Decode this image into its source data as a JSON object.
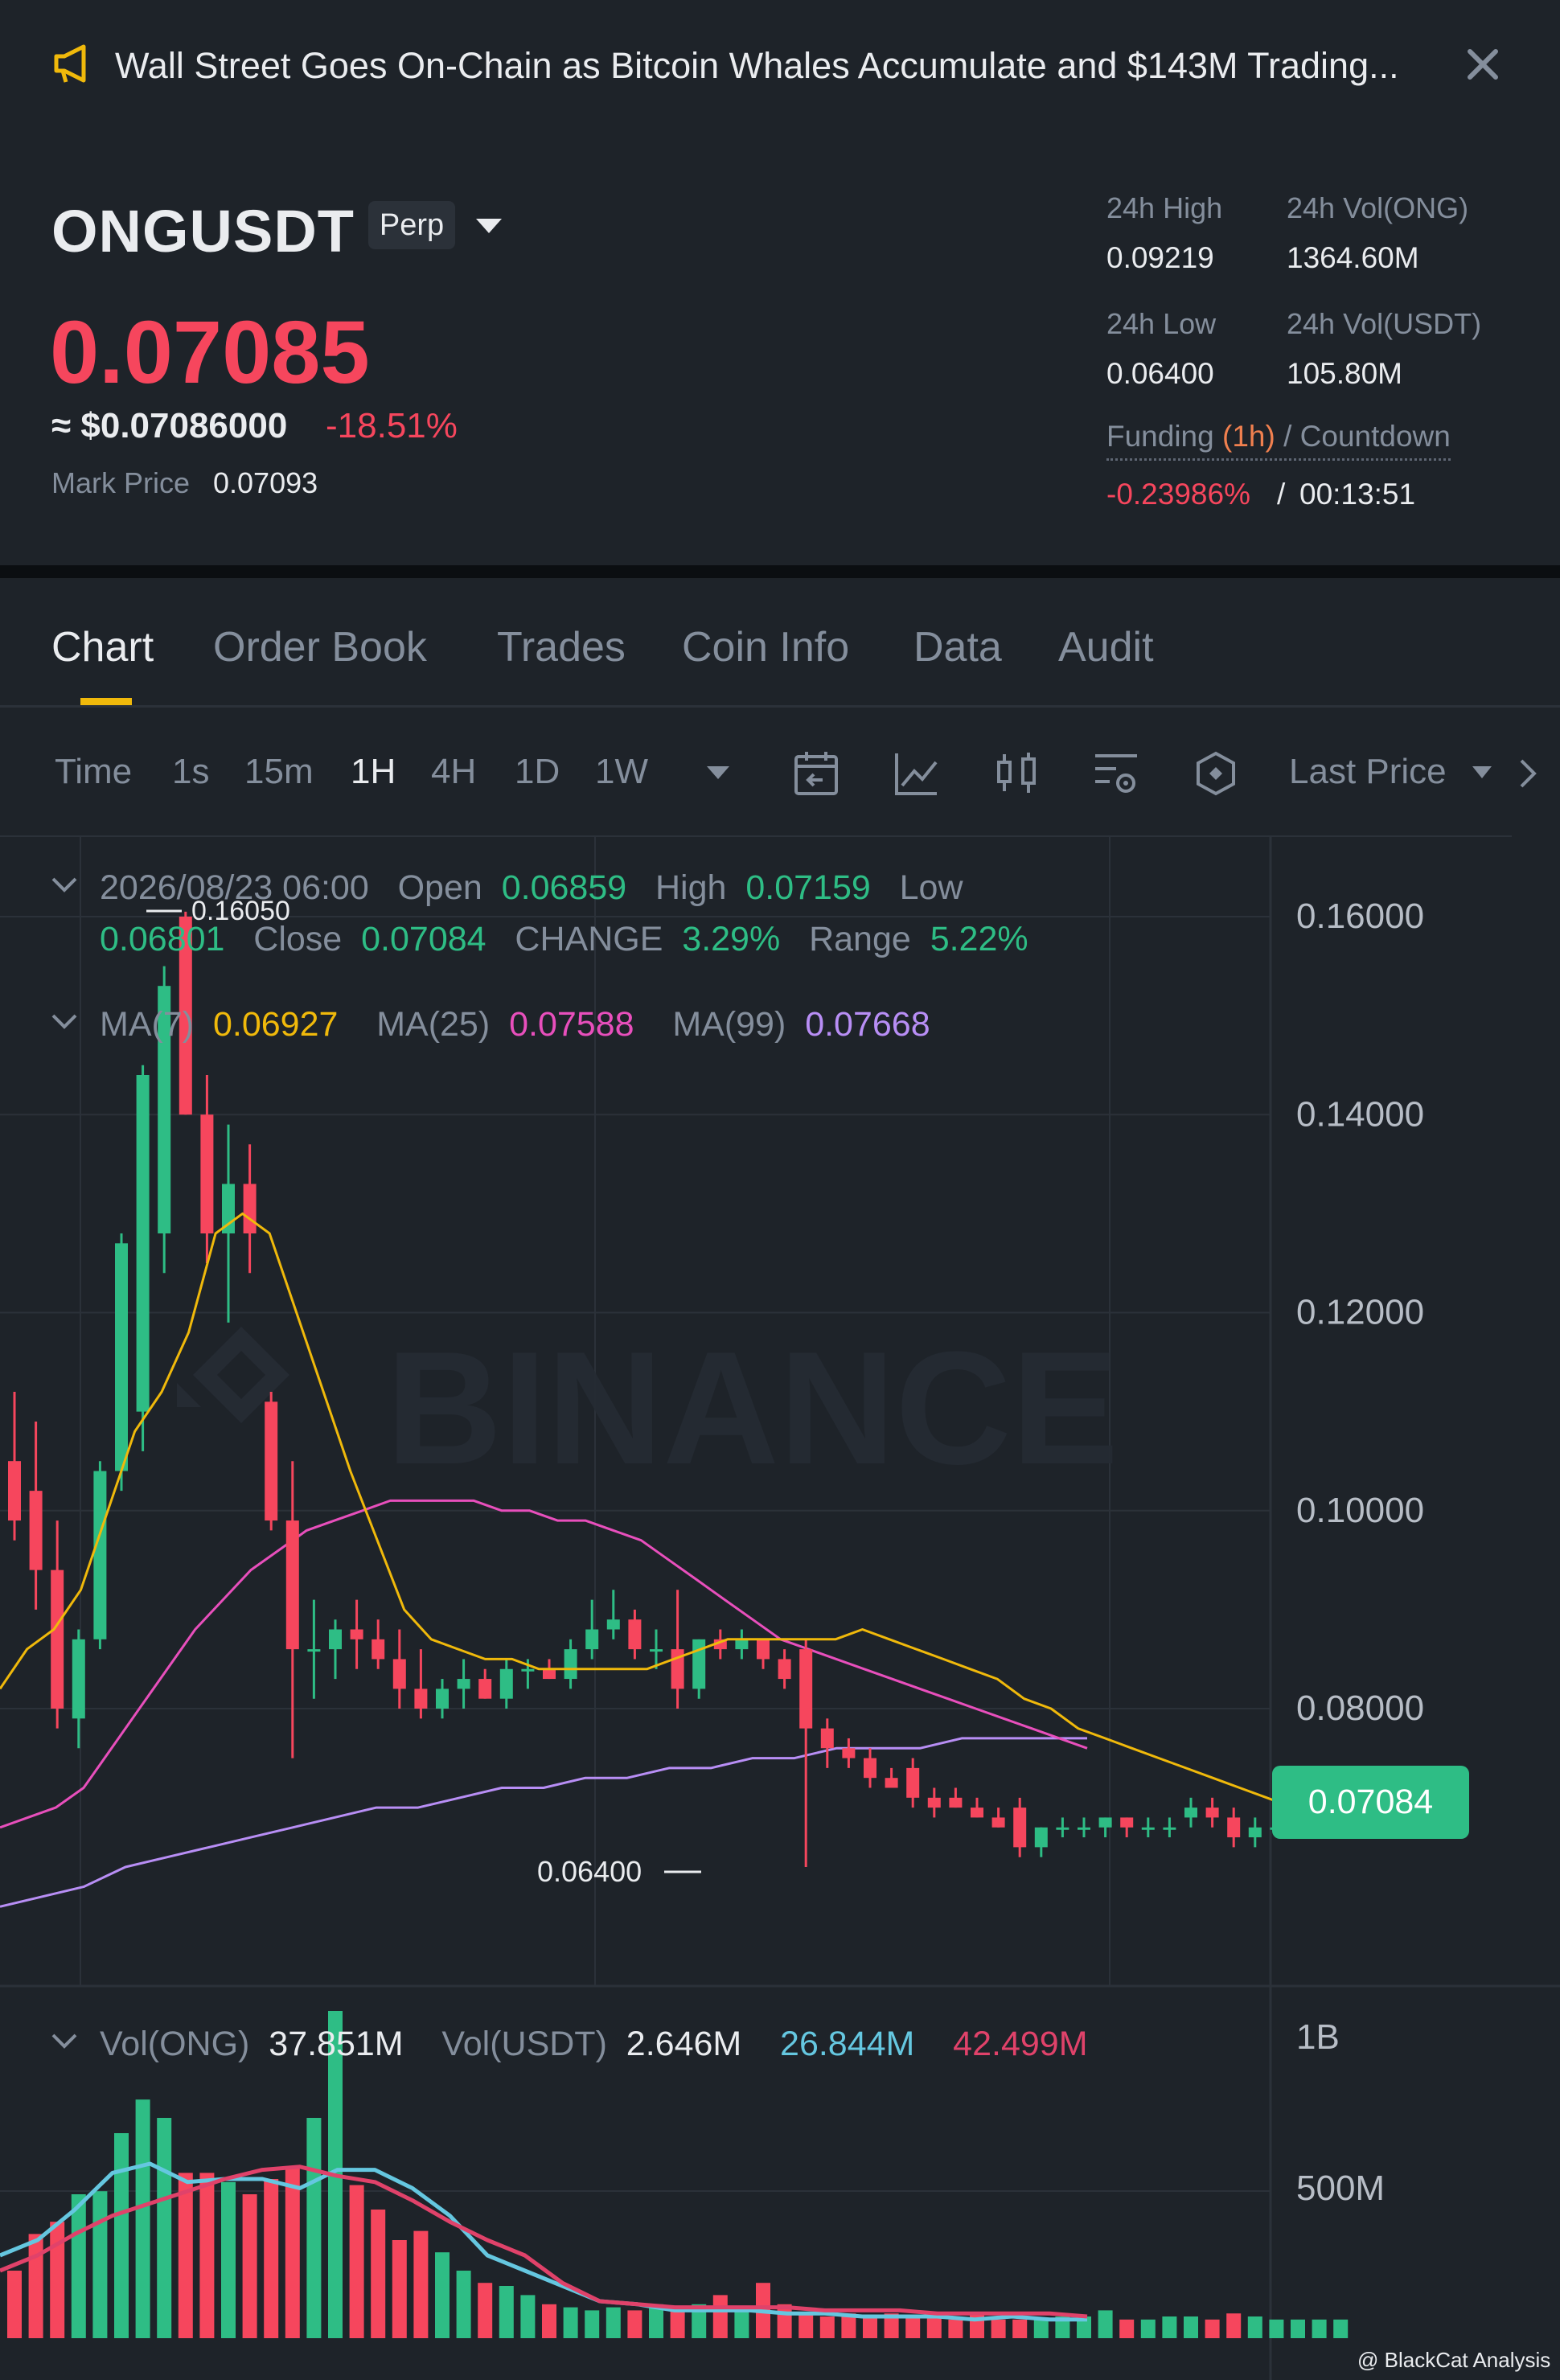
{
  "announcement": {
    "text": "Wall Street Goes On-Chain as Bitcoin Whales Accumulate and $143M Trading..."
  },
  "ticker": {
    "symbol": "ONGUSDT",
    "badge": "Perp",
    "last_price": "0.07085",
    "usd_price": "≈ $0.07086000",
    "change_pct": "-18.51%",
    "mark_label": "Mark Price",
    "mark_value": "0.07093"
  },
  "stats": {
    "high_label": "24h High",
    "high_value": "0.09219",
    "vol_ong_label": "24h Vol(ONG)",
    "vol_ong_value": "1364.60M",
    "low_label": "24h Low",
    "low_value": "0.06400",
    "vol_usdt_label": "24h Vol(USDT)",
    "vol_usdt_value": "105.80M",
    "funding_label": "Funding",
    "funding_interval": "(1h)",
    "countdown_label": "/ Countdown",
    "funding_rate": "-0.23986%",
    "funding_sep": "/",
    "countdown": "00:13:51"
  },
  "tabs": [
    "Chart",
    "Order Book",
    "Trades",
    "Coin Info",
    "Data",
    "Audit"
  ],
  "toolbar": {
    "intervals": [
      "Time",
      "1s",
      "15m",
      "1H",
      "4H",
      "1D",
      "1W"
    ],
    "active_interval": "1H",
    "price_type": "Last Price",
    "icons": [
      "dropdown-icon",
      "calendar-icon",
      "indicator-icon",
      "candle-settings-icon",
      "drawing-settings-icon",
      "shape-icon",
      "chevron-right-icon"
    ]
  },
  "ohlc": {
    "datetime": "2026/08/23 06:00",
    "open_label": "Open",
    "open": "0.06859",
    "high_label": "High",
    "high": "0.07159",
    "low_label": "Low",
    "low": "0.06801",
    "close_label": "Close",
    "close": "0.07084",
    "change_label": "CHANGE",
    "change": "3.29%",
    "range_label": "Range",
    "range": "5.22%"
  },
  "ma": {
    "ma7_label": "MA(7)",
    "ma7": "0.06927",
    "ma25_label": "MA(25)",
    "ma25": "0.07588",
    "ma99_label": "MA(99)",
    "ma99": "0.07668"
  },
  "volume": {
    "vol_ong_label": "Vol(ONG)",
    "vol_ong": "37.851M",
    "vol_usdt_label": "Vol(USDT)",
    "vol_usdt": "2.646M",
    "ma1": "26.844M",
    "ma2": "42.499M"
  },
  "watermark": "BINANCE",
  "attribution": "@ BlackCat Analysis",
  "colors": {
    "up": "#2ebd85",
    "down": "#f6465d",
    "accent": "#f0b90b",
    "ma7": "#f0b90b",
    "ma25": "#e84fbc",
    "ma99": "#b88ef5",
    "vol_ma1": "#65c7e0",
    "vol_ma2": "#e0426a"
  },
  "chart_data": {
    "type": "candlestick",
    "y_ticks": [
      "0.16000",
      "0.14000",
      "0.12000",
      "0.10000",
      "0.08000"
    ],
    "ylim": [
      0.058,
      0.168
    ],
    "current_price": "0.07084",
    "high_marker": "0.16050",
    "low_marker": "0.06400",
    "candles": [
      [
        0.105,
        0.112,
        0.097,
        0.099
      ],
      [
        0.102,
        0.109,
        0.09,
        0.094
      ],
      [
        0.094,
        0.099,
        0.078,
        0.08
      ],
      [
        0.079,
        0.088,
        0.076,
        0.087
      ],
      [
        0.087,
        0.105,
        0.086,
        0.104
      ],
      [
        0.104,
        0.128,
        0.102,
        0.127
      ],
      [
        0.11,
        0.145,
        0.106,
        0.144
      ],
      [
        0.128,
        0.155,
        0.124,
        0.153
      ],
      [
        0.16,
        0.1605,
        0.14,
        0.14
      ],
      [
        0.14,
        0.144,
        0.125,
        0.128
      ],
      [
        0.128,
        0.139,
        0.119,
        0.133
      ],
      [
        0.133,
        0.137,
        0.124,
        0.128
      ],
      [
        0.111,
        0.112,
        0.098,
        0.099
      ],
      [
        0.099,
        0.105,
        0.075,
        0.086
      ],
      [
        0.086,
        0.091,
        0.081,
        0.086
      ],
      [
        0.086,
        0.089,
        0.083,
        0.088
      ],
      [
        0.088,
        0.091,
        0.084,
        0.087
      ],
      [
        0.087,
        0.089,
        0.084,
        0.085
      ],
      [
        0.085,
        0.088,
        0.08,
        0.082
      ],
      [
        0.082,
        0.086,
        0.079,
        0.08
      ],
      [
        0.08,
        0.083,
        0.079,
        0.082
      ],
      [
        0.082,
        0.085,
        0.08,
        0.083
      ],
      [
        0.083,
        0.084,
        0.081,
        0.081
      ],
      [
        0.081,
        0.085,
        0.08,
        0.084
      ],
      [
        0.084,
        0.085,
        0.082,
        0.084
      ],
      [
        0.084,
        0.085,
        0.083,
        0.083
      ],
      [
        0.083,
        0.087,
        0.082,
        0.086
      ],
      [
        0.086,
        0.091,
        0.085,
        0.088
      ],
      [
        0.088,
        0.092,
        0.087,
        0.089
      ],
      [
        0.089,
        0.09,
        0.085,
        0.086
      ],
      [
        0.086,
        0.088,
        0.084,
        0.086
      ],
      [
        0.086,
        0.092,
        0.08,
        0.082
      ],
      [
        0.082,
        0.087,
        0.081,
        0.087
      ],
      [
        0.087,
        0.088,
        0.085,
        0.086
      ],
      [
        0.086,
        0.088,
        0.085,
        0.087
      ],
      [
        0.087,
        0.087,
        0.084,
        0.085
      ],
      [
        0.085,
        0.086,
        0.082,
        0.083
      ],
      [
        0.086,
        0.087,
        0.064,
        0.078
      ],
      [
        0.078,
        0.079,
        0.074,
        0.076
      ],
      [
        0.076,
        0.077,
        0.074,
        0.075
      ],
      [
        0.075,
        0.076,
        0.072,
        0.073
      ],
      [
        0.073,
        0.074,
        0.072,
        0.072
      ],
      [
        0.074,
        0.075,
        0.07,
        0.071
      ],
      [
        0.071,
        0.072,
        0.069,
        0.07
      ],
      [
        0.071,
        0.072,
        0.07,
        0.07
      ],
      [
        0.07,
        0.071,
        0.069,
        0.069
      ],
      [
        0.069,
        0.07,
        0.068,
        0.068
      ],
      [
        0.07,
        0.071,
        0.065,
        0.066
      ],
      [
        0.066,
        0.068,
        0.065,
        0.068
      ],
      [
        0.068,
        0.069,
        0.067,
        0.068
      ],
      [
        0.068,
        0.069,
        0.067,
        0.068
      ],
      [
        0.068,
        0.069,
        0.067,
        0.069
      ],
      [
        0.069,
        0.069,
        0.067,
        0.068
      ],
      [
        0.068,
        0.069,
        0.067,
        0.068
      ],
      [
        0.068,
        0.069,
        0.067,
        0.068
      ],
      [
        0.069,
        0.071,
        0.068,
        0.07
      ],
      [
        0.07,
        0.071,
        0.068,
        0.069
      ],
      [
        0.069,
        0.07,
        0.066,
        0.067
      ],
      [
        0.067,
        0.069,
        0.066,
        0.068
      ],
      [
        0.068,
        0.069,
        0.067,
        0.068
      ],
      [
        0.068,
        0.07,
        0.068,
        0.069
      ],
      [
        0.069,
        0.071,
        0.068,
        0.07
      ],
      [
        0.068,
        0.072,
        0.068,
        0.071
      ]
    ],
    "ma7": [
      0.082,
      0.086,
      0.088,
      0.092,
      0.1,
      0.108,
      0.112,
      0.118,
      0.128,
      0.13,
      0.128,
      0.12,
      0.112,
      0.104,
      0.097,
      0.09,
      0.087,
      0.086,
      0.085,
      0.085,
      0.084,
      0.084,
      0.084,
      0.084,
      0.084,
      0.085,
      0.086,
      0.087,
      0.087,
      0.087,
      0.087,
      0.087,
      0.088,
      0.087,
      0.086,
      0.085,
      0.084,
      0.083,
      0.081,
      0.08,
      0.078,
      0.077,
      0.076,
      0.075,
      0.074,
      0.073,
      0.072,
      0.071,
      0.07,
      0.07,
      0.069,
      0.069,
      0.069,
      0.069
    ],
    "ma25": [
      0.068,
      0.069,
      0.07,
      0.072,
      0.076,
      0.08,
      0.084,
      0.088,
      0.091,
      0.094,
      0.096,
      0.098,
      0.099,
      0.1,
      0.101,
      0.101,
      0.101,
      0.101,
      0.1,
      0.1,
      0.099,
      0.099,
      0.098,
      0.097,
      0.095,
      0.093,
      0.091,
      0.089,
      0.087,
      0.086,
      0.085,
      0.084,
      0.083,
      0.082,
      0.081,
      0.08,
      0.079,
      0.078,
      0.077,
      0.076
    ],
    "ma99": [
      0.06,
      0.061,
      0.062,
      0.064,
      0.065,
      0.066,
      0.067,
      0.068,
      0.069,
      0.07,
      0.07,
      0.071,
      0.072,
      0.072,
      0.073,
      0.073,
      0.074,
      0.074,
      0.075,
      0.075,
      0.076,
      0.076,
      0.076,
      0.077,
      0.077,
      0.077,
      0.077
    ],
    "volume_y_ticks": [
      "1B",
      "500M"
    ],
    "volume": [
      0.2,
      0.32,
      0.36,
      0.45,
      0.46,
      0.65,
      0.76,
      0.7,
      0.52,
      0.52,
      0.49,
      0.45,
      0.5,
      0.54,
      0.7,
      1.05,
      0.48,
      0.4,
      0.3,
      0.33,
      0.26,
      0.2,
      0.16,
      0.15,
      0.12,
      0.09,
      0.08,
      0.07,
      0.08,
      0.07,
      0.09,
      0.07,
      0.09,
      0.12,
      0.08,
      0.16,
      0.09,
      0.06,
      0.05,
      0.06,
      0.05,
      0.06,
      0.05,
      0.05,
      0.04,
      0.06,
      0.04,
      0.04,
      0.04,
      0.05,
      0.05,
      0.07,
      0.04,
      0.04,
      0.05,
      0.05,
      0.04,
      0.06,
      0.05,
      0.04,
      0.04,
      0.04,
      0.04
    ],
    "volume_ma1": [
      0.25,
      0.3,
      0.4,
      0.52,
      0.55,
      0.49,
      0.5,
      0.5,
      0.47,
      0.53,
      0.53,
      0.47,
      0.38,
      0.25,
      0.2,
      0.15,
      0.1,
      0.09,
      0.07,
      0.07,
      0.07,
      0.06,
      0.06,
      0.05,
      0.05,
      0.05,
      0.04,
      0.05,
      0.04,
      0.04
    ],
    "volume_ma2": [
      0.2,
      0.25,
      0.32,
      0.38,
      0.42,
      0.46,
      0.5,
      0.53,
      0.54,
      0.51,
      0.49,
      0.43,
      0.36,
      0.3,
      0.25,
      0.16,
      0.1,
      0.09,
      0.08,
      0.08,
      0.08,
      0.08,
      0.07,
      0.07,
      0.07,
      0.06,
      0.06,
      0.06,
      0.06,
      0.05
    ]
  }
}
